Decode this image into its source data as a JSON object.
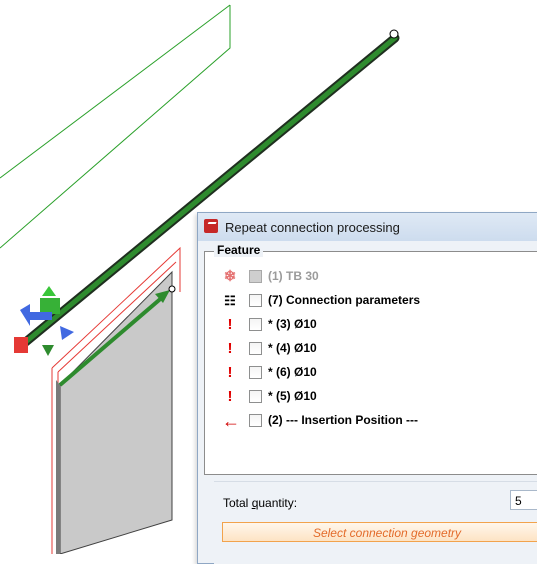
{
  "dialog": {
    "title": "Repeat connection processing",
    "feature_legend": "Feature",
    "items": [
      {
        "label": "(1) TB 30",
        "icon": "tb-icon",
        "checked": false,
        "disabled": true
      },
      {
        "label": "(7) Connection parameters",
        "icon": "connection-params-icon",
        "checked": false,
        "disabled": false
      },
      {
        "label": "* (3)  Ø10",
        "icon": "exclamation-icon",
        "checked": false,
        "disabled": false
      },
      {
        "label": "* (4)  Ø10",
        "icon": "exclamation-icon",
        "checked": false,
        "disabled": false
      },
      {
        "label": "* (6)  Ø10",
        "icon": "exclamation-icon",
        "checked": false,
        "disabled": false
      },
      {
        "label": "* (5)  Ø10",
        "icon": "exclamation-icon",
        "checked": false,
        "disabled": false
      },
      {
        "label": "(2)  --- Insertion Position ---",
        "icon": "red-arrow-icon",
        "checked": false,
        "disabled": false
      }
    ],
    "quantity_label_pre": "Total ",
    "quantity_label_underlined": "q",
    "quantity_label_post": "uantity:",
    "quantity_value": "5",
    "select_button_label": "Select connection geometry"
  },
  "colors": {
    "accent_green": "#2e8b2e",
    "panel_red": "#e53935",
    "button_orange": "#e36b2a"
  }
}
